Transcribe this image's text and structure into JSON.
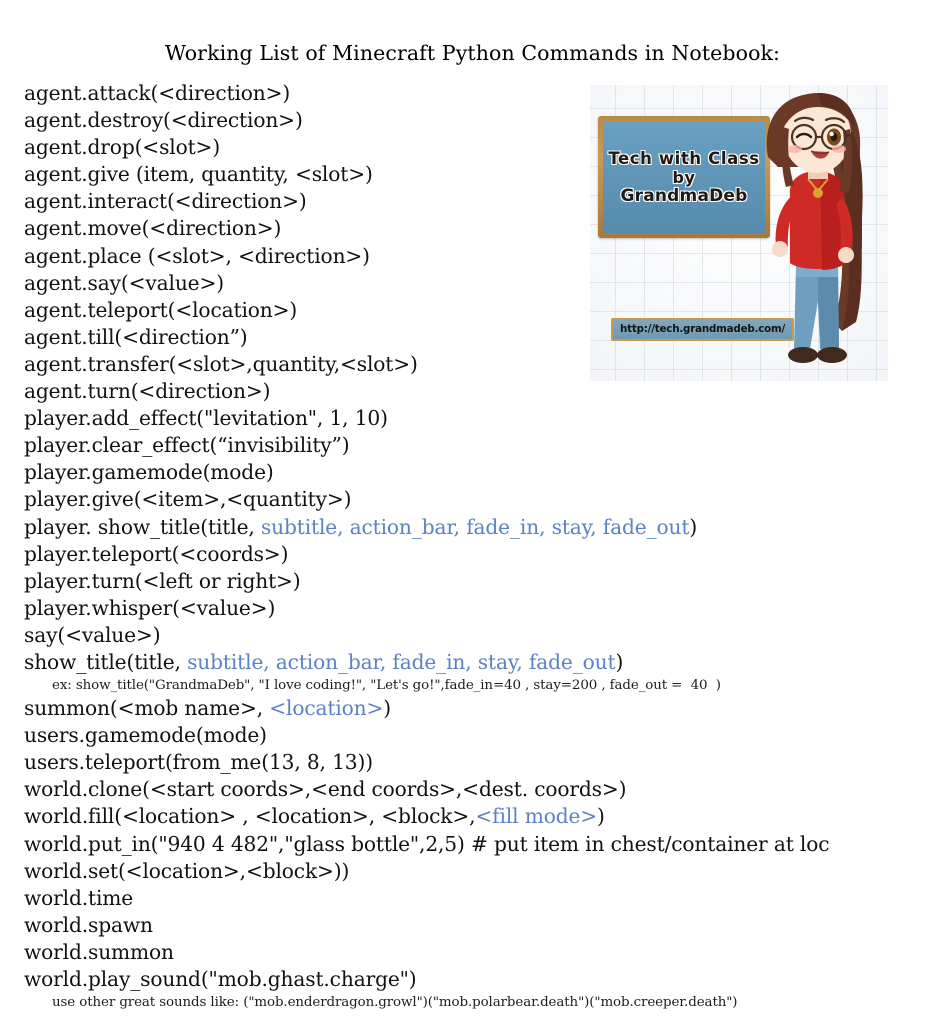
{
  "document": {
    "title": "Working List of Minecraft Python Commands in Notebook:"
  },
  "theme": {
    "text_color": "#111111",
    "highlight_blue": "#5b81c6",
    "chalkboard_blue": "#5e93b6",
    "chalkboard_frame": "#c09350",
    "page_background": "#ffffff"
  },
  "commands": [
    {
      "kind": "command",
      "segments": [
        {
          "text": "agent.attack(<direction>)",
          "color": "black"
        }
      ]
    },
    {
      "kind": "command",
      "segments": [
        {
          "text": "agent.destroy(<direction>)",
          "color": "black"
        }
      ]
    },
    {
      "kind": "command",
      "segments": [
        {
          "text": "agent.drop(<slot>)",
          "color": "black"
        }
      ]
    },
    {
      "kind": "command",
      "segments": [
        {
          "text": "agent.give (item, quantity, <slot>)",
          "color": "black"
        }
      ]
    },
    {
      "kind": "command",
      "segments": [
        {
          "text": "agent.interact(<direction>)",
          "color": "black"
        }
      ]
    },
    {
      "kind": "command",
      "segments": [
        {
          "text": "agent.move(<direction>)",
          "color": "black"
        }
      ]
    },
    {
      "kind": "command",
      "segments": [
        {
          "text": "agent.place (<slot>, <direction>)",
          "color": "black"
        }
      ]
    },
    {
      "kind": "command",
      "segments": [
        {
          "text": "agent.say(<value>)",
          "color": "black"
        }
      ]
    },
    {
      "kind": "command",
      "segments": [
        {
          "text": "agent.teleport(<location>)",
          "color": "black"
        }
      ]
    },
    {
      "kind": "command",
      "segments": [
        {
          "text": "agent.till(<direction”)",
          "color": "black"
        }
      ]
    },
    {
      "kind": "command",
      "segments": [
        {
          "text": "agent.transfer(<slot>,quantity,<slot>)",
          "color": "black"
        }
      ]
    },
    {
      "kind": "command",
      "segments": [
        {
          "text": "agent.turn(<direction>)",
          "color": "black"
        }
      ]
    },
    {
      "kind": "command",
      "segments": [
        {
          "text": "player.add_effect(\"levitation\", 1, 10)",
          "color": "black"
        }
      ]
    },
    {
      "kind": "command",
      "segments": [
        {
          "text": "player.clear_effect(“invisibility”)",
          "color": "black"
        }
      ]
    },
    {
      "kind": "command",
      "segments": [
        {
          "text": "player.gamemode(mode)",
          "color": "black"
        }
      ]
    },
    {
      "kind": "command",
      "segments": [
        {
          "text": "player.give(<item>,<quantity>)",
          "color": "black"
        }
      ]
    },
    {
      "kind": "command",
      "segments": [
        {
          "text": "player. show_title(title,",
          "color": "black"
        },
        {
          "text": " subtitle, action_bar, fade_in, stay, fade_out",
          "color": "blue"
        },
        {
          "text": ")",
          "color": "black"
        }
      ]
    },
    {
      "kind": "command",
      "segments": [
        {
          "text": "player.teleport(<coords>)",
          "color": "black"
        }
      ]
    },
    {
      "kind": "command",
      "segments": [
        {
          "text": "player.turn(<left or right>)",
          "color": "black"
        }
      ]
    },
    {
      "kind": "command",
      "segments": [
        {
          "text": "player.whisper(<value>)",
          "color": "black"
        }
      ]
    },
    {
      "kind": "command",
      "segments": [
        {
          "text": "say(<value>)",
          "color": "black"
        }
      ]
    },
    {
      "kind": "command",
      "segments": [
        {
          "text": "show_title(title,",
          "color": "black"
        },
        {
          "text": " subtitle, action_bar, fade_in, stay, fade_out",
          "color": "blue"
        },
        {
          "text": ")",
          "color": "black"
        }
      ]
    },
    {
      "kind": "note",
      "segments": [
        {
          "text": "ex: show_title(\"GrandmaDeb\", \"I love coding!\", \"Let's go!\",fade_in=40 , stay=200 , fade_out =  40  )",
          "color": "black"
        }
      ]
    },
    {
      "kind": "command",
      "segments": [
        {
          "text": "summon(<mob name>,",
          "color": "black"
        },
        {
          "text": " <location>",
          "color": "blue"
        },
        {
          "text": ")",
          "color": "black"
        }
      ]
    },
    {
      "kind": "command",
      "segments": [
        {
          "text": "users.gamemode(mode)",
          "color": "black"
        }
      ]
    },
    {
      "kind": "command",
      "segments": [
        {
          "text": "users.teleport(from_me(13, 8, 13))",
          "color": "black"
        }
      ]
    },
    {
      "kind": "command",
      "segments": [
        {
          "text": "world.clone(<start coords>,<end coords>,<dest. coords>)",
          "color": "black"
        }
      ]
    },
    {
      "kind": "command",
      "segments": [
        {
          "text": "world.fill(<location> , <location>, <block>,",
          "color": "black"
        },
        {
          "text": "<fill mode>",
          "color": "blue"
        },
        {
          "text": ")",
          "color": "black"
        }
      ]
    },
    {
      "kind": "command",
      "segments": [
        {
          "text": "world.put_in(\"940 4 482\",\"glass bottle\",2,5) # put item in chest/container at loc",
          "color": "black"
        }
      ]
    },
    {
      "kind": "command",
      "segments": [
        {
          "text": "world.set(<location>,<block>))",
          "color": "black"
        }
      ]
    },
    {
      "kind": "command",
      "segments": [
        {
          "text": "world.time",
          "color": "black"
        }
      ]
    },
    {
      "kind": "command",
      "segments": [
        {
          "text": "world.spawn",
          "color": "black"
        }
      ]
    },
    {
      "kind": "command",
      "segments": [
        {
          "text": "world.summon",
          "color": "black"
        }
      ]
    },
    {
      "kind": "command",
      "segments": [
        {
          "text": "world.play_sound(\"mob.ghast.charge\")",
          "color": "black"
        }
      ]
    },
    {
      "kind": "note",
      "segments": [
        {
          "text": "use other great sounds like: (\"mob.enderdragon.growl\")(\"mob.polarbear.death\")(\"mob.creeper.death\")",
          "color": "black"
        }
      ]
    }
  ],
  "logo": {
    "board_line1": "Tech with Class",
    "board_line2": "by",
    "board_line3": "GrandmaDeb",
    "url": "http://tech.grandmadeb.com/"
  }
}
